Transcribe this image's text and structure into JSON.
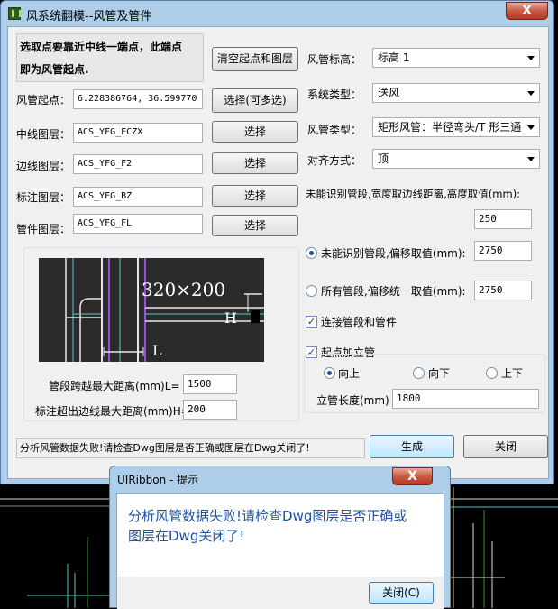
{
  "window": {
    "title": "风系统翻模--风管及管件",
    "close_glyph": "X"
  },
  "info": {
    "line1": "选取点要靠近中线一端点，此端点",
    "line2": "即为风管起点."
  },
  "buttons": {
    "clear": "清空起点和图层",
    "select_multi": "选择(可多选)",
    "select": "选择",
    "generate": "生成",
    "close": "关闭"
  },
  "fields": {
    "start_point": {
      "label": "风管起点：",
      "value": "6.228386764, 36.599770"
    },
    "center_layer": {
      "label": "中线图层：",
      "value": "ACS_YFG_FCZX"
    },
    "edge_layer": {
      "label": "边线图层：",
      "value": "ACS_YFG_F2"
    },
    "annot_layer": {
      "label": "标注图层：",
      "value": "ACS_YFG_BZ"
    },
    "fitting_layer": {
      "label": "管件图层：",
      "value": "ACS_YFG_FL"
    }
  },
  "right": {
    "elevation": {
      "label": "风管标高：",
      "value": "标高 1"
    },
    "system": {
      "label": "系统类型：",
      "value": "送风"
    },
    "duct_type": {
      "label": "风管类型：",
      "value": "矩形风管：半径弯头/T 形三通"
    },
    "align": {
      "label": "对齐方式：",
      "value": "顶"
    },
    "unrecognized_note": "未能识别管段,宽度取边线距离,高度取值(mm):",
    "height_value": "250",
    "radio_unrecognized": {
      "label": "未能识别管段,偏移取值(mm):",
      "value": "2750",
      "checked": true
    },
    "radio_all": {
      "label": "所有管段,偏移统一取值(mm):",
      "value": "2750",
      "checked": false
    },
    "connect": {
      "label": "连接管段和管件",
      "checked": true
    },
    "start_riser": {
      "label": "起点加立管",
      "checked": true
    },
    "direction": {
      "up": "向上",
      "down": "向下",
      "updown": "上下",
      "selected": "up"
    },
    "riser_length": {
      "label": "立管长度(mm)",
      "value": "1800"
    }
  },
  "preview": {
    "dim_text": "320×200",
    "span_label": "L",
    "height_label": "H"
  },
  "params": {
    "max_span": {
      "label": "管段跨越最大距离(mm)L=",
      "value": "1500"
    },
    "max_annot": {
      "label": "标注超出边线最大距离(mm)H=",
      "value": "200"
    }
  },
  "status": "分析风管数据失败!请检查Dwg图层是否正确或图层在Dwg关闭了!",
  "dialog": {
    "title": "UIRibbon - 提示",
    "message_line1": "分析风管数据失败!请检查Dwg图层是否正确或",
    "message_line2": "图层在Dwg关闭了!",
    "close_button": "关闭(C)",
    "close_glyph": "X"
  },
  "colors": {
    "title_bg": "#aecde8",
    "accent_text": "#1f4fa0",
    "close_red": "#c75b45",
    "cad_bg": "#000000"
  }
}
